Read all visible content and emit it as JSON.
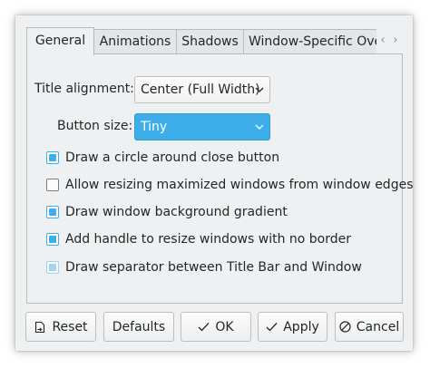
{
  "tabs": [
    {
      "label": "General",
      "active": true
    },
    {
      "label": "Animations",
      "active": false
    },
    {
      "label": "Shadows",
      "active": false
    },
    {
      "label": "Window-Specific Ove",
      "active": false
    }
  ],
  "tab_scroll": {
    "left": "‹",
    "right": "›"
  },
  "general": {
    "title_alignment_label": "Title alignment:",
    "title_alignment_value": "Center (Full Width)",
    "button_size_label": "Button size:",
    "button_size_value": "Tiny",
    "options": [
      {
        "label": "Draw a circle around close button",
        "checked": true
      },
      {
        "label": "Allow resizing maximized windows from window edges",
        "checked": false
      },
      {
        "label": "Draw window background gradient",
        "checked": true
      },
      {
        "label": "Add handle to resize windows with no border",
        "checked": true
      },
      {
        "label": "Draw separator between Title Bar and Window",
        "checked": true,
        "disabled": true
      }
    ]
  },
  "buttons": {
    "reset": "Reset",
    "defaults": "Defaults",
    "ok": "OK",
    "apply": "Apply",
    "cancel": "Cancel"
  },
  "colors": {
    "accent": "#3daee9",
    "window_bg": "#eff0f1",
    "text": "#232627"
  },
  "icons": {
    "reset": "reset-document-icon",
    "ok": "checkmark-icon",
    "apply": "checkmark-icon",
    "cancel": "cancel-circle-icon",
    "combo": "chevron-down-icon"
  }
}
